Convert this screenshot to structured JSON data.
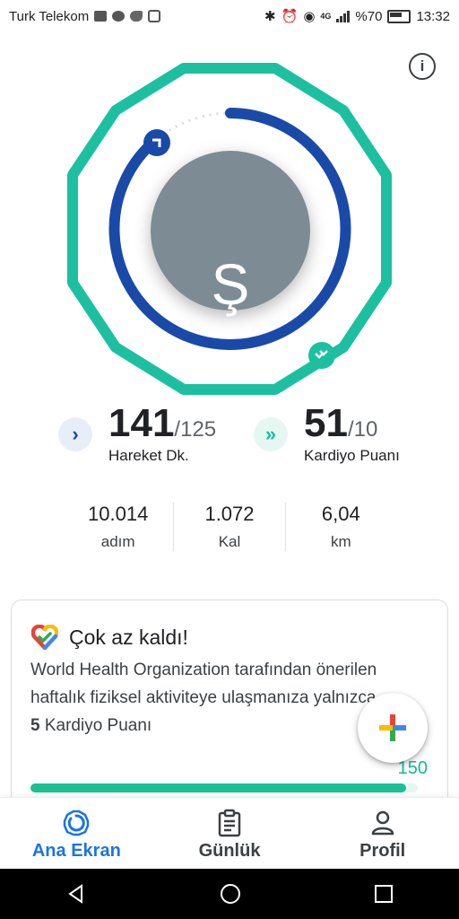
{
  "status_bar": {
    "carrier": "Turk Telekom",
    "battery": "%70",
    "network": "4G",
    "time": "13:32"
  },
  "rings": {
    "avatar_letter": "Ş",
    "move_progress": 1.128,
    "heart_progress": 5.1,
    "move_color": "#1a4aa8",
    "heart_color": "#1cc0a0"
  },
  "metrics": {
    "move": {
      "value": "141",
      "goal": "/125",
      "label": "Hareket Dk."
    },
    "heart": {
      "value": "51",
      "goal": "/10",
      "label": "Kardiyo Puanı"
    }
  },
  "stats": [
    {
      "value": "10.014",
      "unit": "adım"
    },
    {
      "value": "1.072",
      "unit": "Kal"
    },
    {
      "value": "6,04",
      "unit": "km"
    }
  ],
  "card": {
    "title": "Çok az kaldı!",
    "body_prefix": "World Health Organization tarafından önerilen haftalık fiziksel aktiviteye ulaşmanıza yalnızca ",
    "body_highlight": "5",
    "body_suffix": " Kardiyo Puanı",
    "progress_value": "150",
    "progress_fraction": 0.97
  },
  "bottom_nav": [
    {
      "label": "Ana Ekran",
      "active": true
    },
    {
      "label": "Günlük",
      "active": false
    },
    {
      "label": "Profil",
      "active": false
    }
  ],
  "colors": {
    "accent_blue": "#1a73e8",
    "teal": "#1cc0a0",
    "avatar_bg": "#7d8c94"
  }
}
